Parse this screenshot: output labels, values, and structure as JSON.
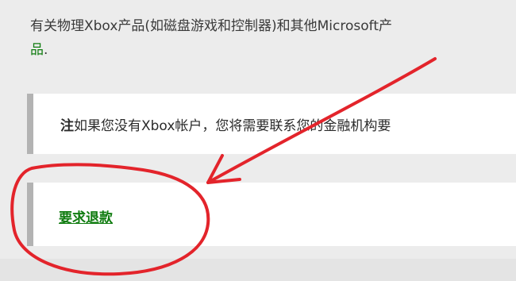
{
  "article": {
    "intro_line1": "有关物理Xbox产品(如磁盘游戏和控制器)和其他Microsoft产",
    "intro_link": "品",
    "intro_period": "."
  },
  "note": {
    "label": "注",
    "text": "如果您没有Xbox帐户，您将需要联系您的金融机构要"
  },
  "refund": {
    "link_label": "要求退款"
  },
  "colors": {
    "link_green": "#107c10",
    "annotation_red": "#e3242b",
    "callout_border": "#b3b3b3"
  }
}
